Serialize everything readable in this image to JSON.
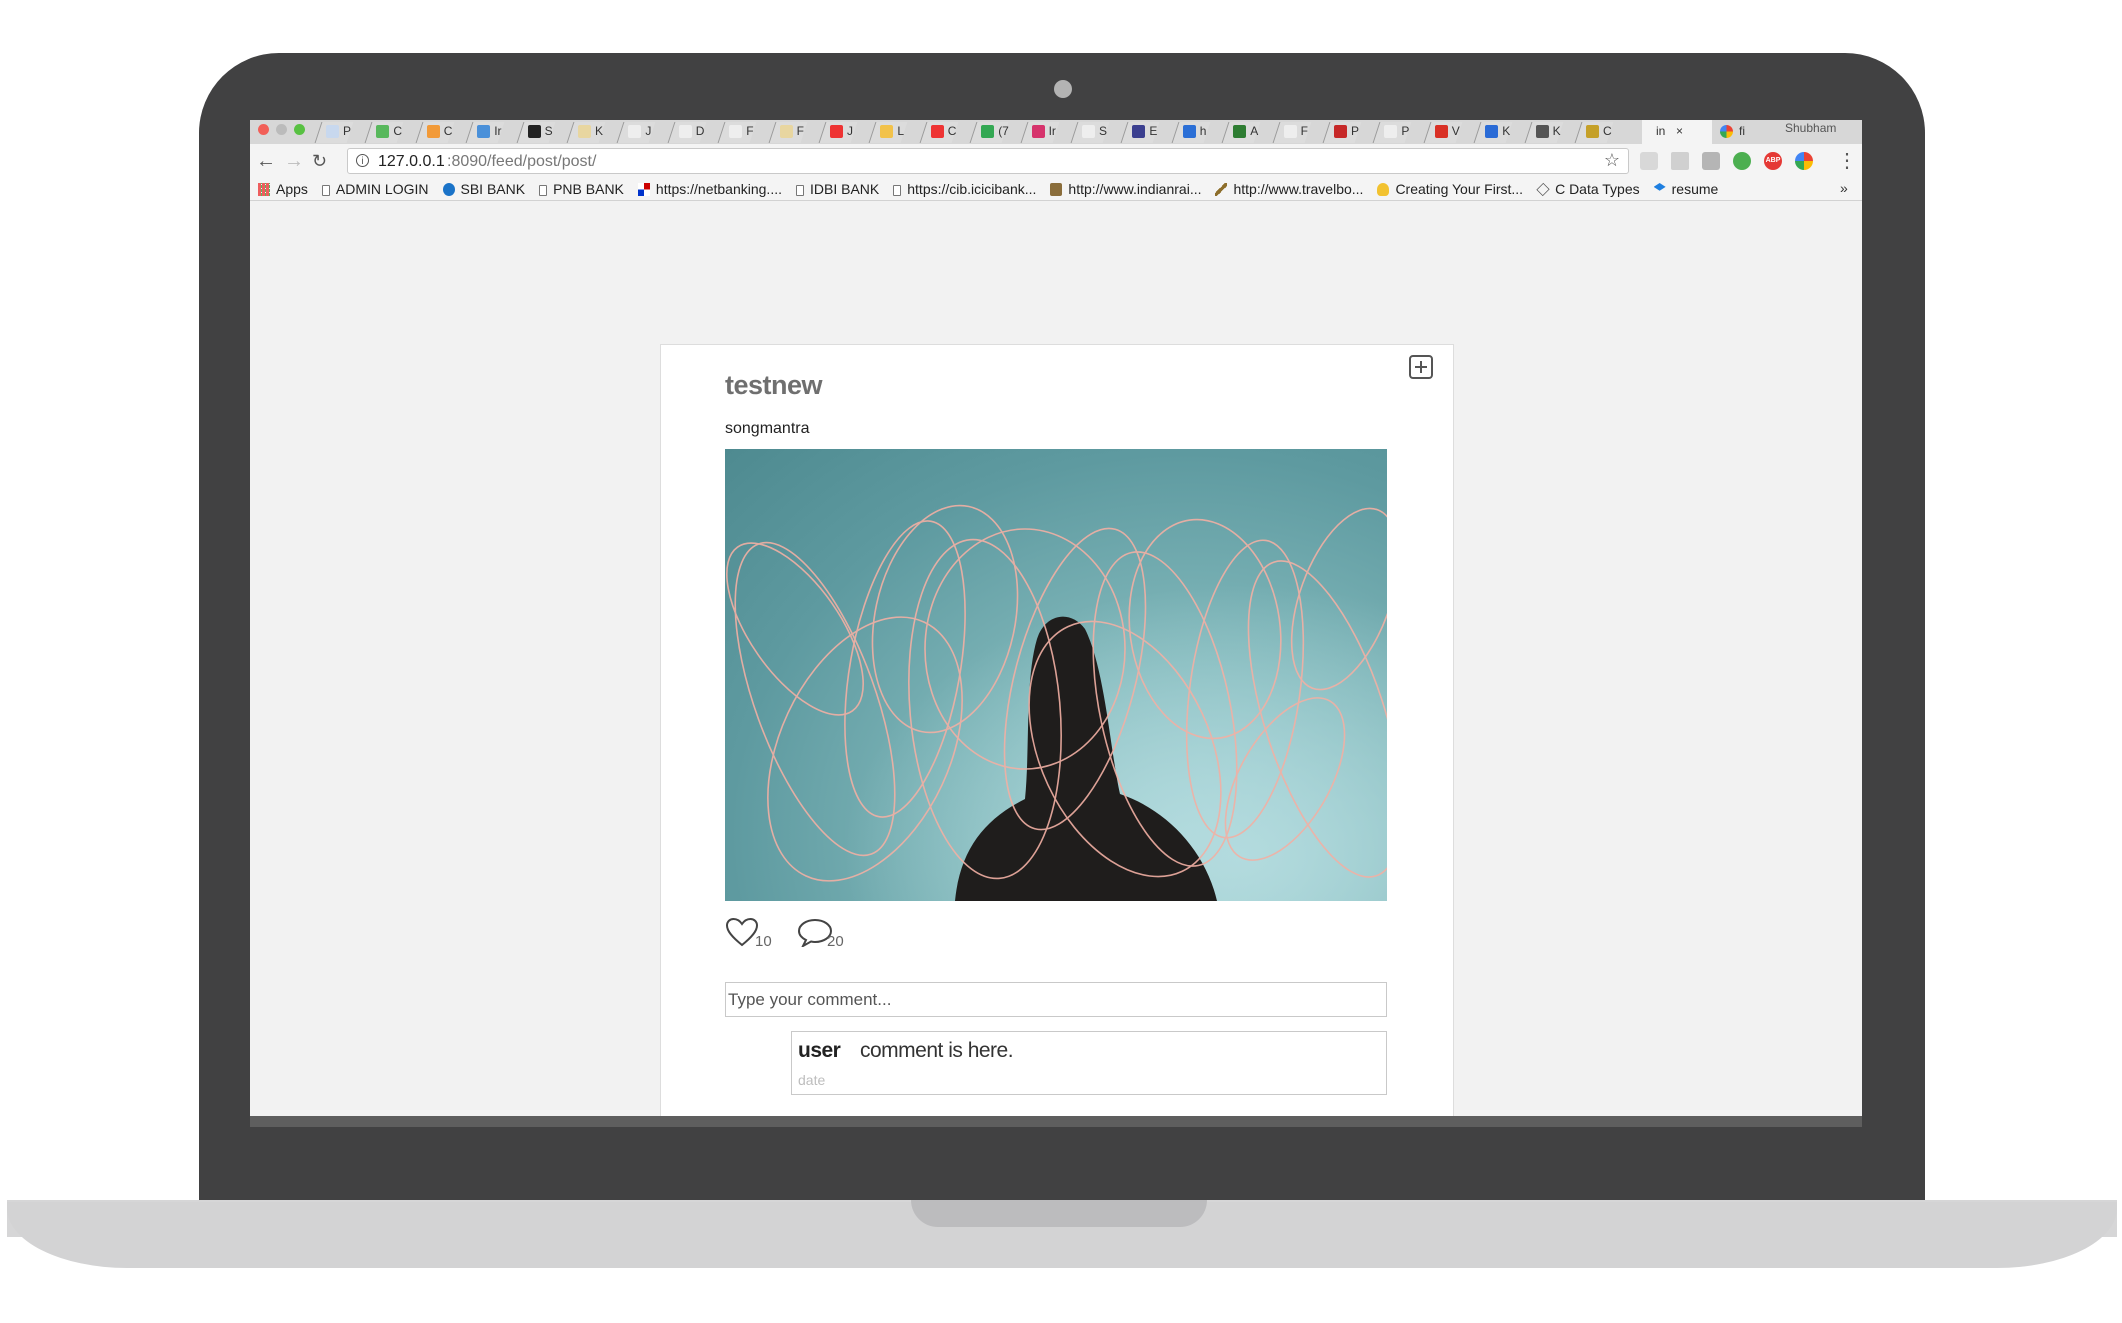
{
  "browser": {
    "tab_letters": [
      "P",
      "C",
      "C",
      "Ir",
      "S",
      "K",
      "J",
      "D",
      "F",
      "F",
      "J",
      "L",
      "C",
      "(7",
      "Ir",
      "S",
      "E",
      "h",
      "A",
      "F",
      "P",
      "P",
      "V",
      "K",
      "K",
      "C"
    ],
    "active_tab_label": "in",
    "active_tab_close": "×",
    "next_tab_label": "fi",
    "profile_name": "Shubham",
    "url_host": "127.0.0.1",
    "url_path": ":8090/feed/post/post/",
    "bookmarks": [
      {
        "label": "Apps",
        "icon": "apps-grid-icon"
      },
      {
        "label": "ADMIN LOGIN",
        "icon": "page-icon"
      },
      {
        "label": "SBI BANK",
        "icon": "sbi-icon"
      },
      {
        "label": "PNB BANK",
        "icon": "page-icon"
      },
      {
        "label": "https://netbanking....",
        "icon": "bank-icon"
      },
      {
        "label": "IDBI BANK",
        "icon": "page-icon"
      },
      {
        "label": "https://cib.icicibank...",
        "icon": "page-icon"
      },
      {
        "label": "http://www.indianrai...",
        "icon": "rail-icon"
      },
      {
        "label": "http://www.travelbo...",
        "icon": "feather-icon"
      },
      {
        "label": "Creating Your First...",
        "icon": "bulb-icon"
      },
      {
        "label": "C Data Types",
        "icon": "diamond-icon"
      },
      {
        "label": "resume",
        "icon": "dropbox-icon"
      }
    ],
    "bookmarks_more": "»"
  },
  "post": {
    "title": "testnew",
    "author": "songmantra",
    "likes": "10",
    "comments": "20",
    "comment_placeholder": "Type your comment...",
    "comment": {
      "user": "user",
      "text": "comment is here.",
      "date": "date"
    }
  },
  "colors": {
    "frame": "#414142",
    "page_background": "#f2f2f2",
    "title": "#6f6f6f",
    "image_teal": "#6aa6aa",
    "sparkler": "#f2b0a4"
  }
}
